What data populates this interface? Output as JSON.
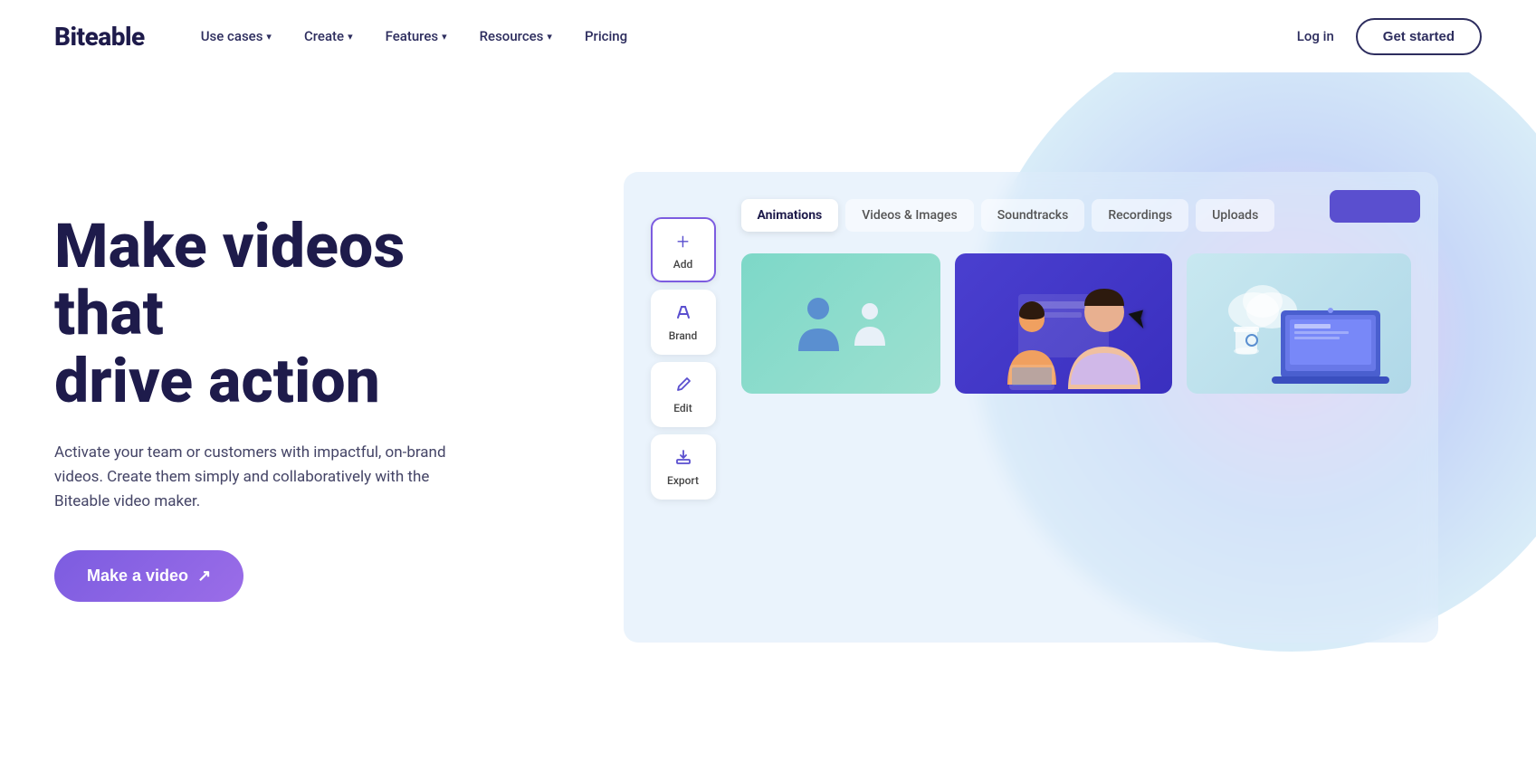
{
  "brand": {
    "logo": "Biteable"
  },
  "nav": {
    "items": [
      {
        "label": "Use cases",
        "hasDropdown": true
      },
      {
        "label": "Create",
        "hasDropdown": true
      },
      {
        "label": "Features",
        "hasDropdown": true
      },
      {
        "label": "Resources",
        "hasDropdown": true
      },
      {
        "label": "Pricing",
        "hasDropdown": false
      }
    ],
    "login_label": "Log in",
    "get_started_label": "Get started"
  },
  "hero": {
    "title_line1": "Make videos that",
    "title_line2": "drive action",
    "subtitle": "Activate your team or customers with impactful, on-brand videos. Create them simply and collaboratively with the Biteable video maker.",
    "cta_label": "Make a video"
  },
  "mockup": {
    "sidebar": [
      {
        "icon": "+",
        "label": "Add",
        "active": true
      },
      {
        "icon": "◇",
        "label": "Brand",
        "active": false
      },
      {
        "icon": "✎",
        "label": "Edit",
        "active": false
      },
      {
        "icon": "⤴",
        "label": "Export",
        "active": false
      }
    ],
    "tabs": [
      {
        "label": "Animations",
        "active": true
      },
      {
        "label": "Videos & Images",
        "active": false
      },
      {
        "label": "Soundtracks",
        "active": false
      },
      {
        "label": "Recordings",
        "active": false
      },
      {
        "label": "Uploads",
        "active": false
      }
    ]
  }
}
